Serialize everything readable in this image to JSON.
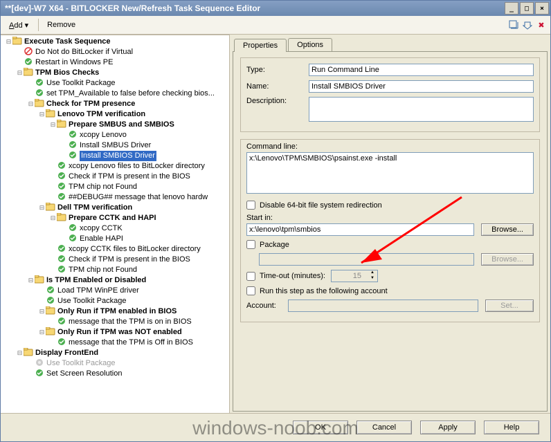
{
  "titlebar": {
    "title": "**[dev]-W7 X64 - BITLOCKER New/Refresh Task Sequence Editor"
  },
  "menu": {
    "add": "Add",
    "remove": "Remove"
  },
  "tabs": {
    "properties": "Properties",
    "options": "Options"
  },
  "properties": {
    "type_label": "Type:",
    "type_value": "Run Command Line",
    "name_label": "Name:",
    "name_value": "Install SMBIOS Driver",
    "description_label": "Description:",
    "description_value": "",
    "commandline_label": "Command line:",
    "commandline_value": "x:\\Lenovo\\TPM\\SMBIOS\\psainst.exe -install",
    "disable64_label": "Disable 64-bit file system redirection",
    "startin_label": "Start in:",
    "startin_value": "x:\\lenovo\\tpm\\smbios",
    "browse_label": "Browse...",
    "package_label": "Package",
    "package_value": "",
    "timeout_label": "Time-out (minutes):",
    "timeout_value": "15",
    "runas_label": "Run this step as the following account",
    "account_label": "Account:",
    "account_value": "",
    "set_label": "Set..."
  },
  "buttons": {
    "ok": "OK",
    "cancel": "Cancel",
    "apply": "Apply",
    "help": "Help"
  },
  "watermark": "windows-noob.com",
  "tree": [
    {
      "d": 0,
      "t": "g",
      "l": "Execute Task Sequence",
      "tw": "-"
    },
    {
      "d": 1,
      "t": "x",
      "l": "Do Not do BitLocker if Virtual"
    },
    {
      "d": 1,
      "t": "s",
      "l": "Restart in Windows PE"
    },
    {
      "d": 1,
      "t": "g",
      "l": "TPM Bios Checks",
      "tw": "-"
    },
    {
      "d": 2,
      "t": "s",
      "l": "Use Toolkit Package"
    },
    {
      "d": 2,
      "t": "s",
      "l": "set TPM_Available to false before checking bios..."
    },
    {
      "d": 2,
      "t": "g",
      "l": "Check for TPM presence",
      "tw": "-"
    },
    {
      "d": 3,
      "t": "g",
      "l": "Lenovo TPM verification",
      "tw": "-"
    },
    {
      "d": 4,
      "t": "g",
      "l": "Prepare SMBUS and SMBIOS",
      "tw": "-"
    },
    {
      "d": 5,
      "t": "s",
      "l": "xcopy Lenovo"
    },
    {
      "d": 5,
      "t": "s",
      "l": "Install SMBUS Driver"
    },
    {
      "d": 5,
      "t": "s",
      "l": "Install SMBIOS Driver",
      "sel": true
    },
    {
      "d": 4,
      "t": "s",
      "l": "xcopy Lenovo files to BitLocker directory"
    },
    {
      "d": 4,
      "t": "s",
      "l": "Check if TPM is present in the BIOS"
    },
    {
      "d": 4,
      "t": "s",
      "l": "TPM chip not Found"
    },
    {
      "d": 4,
      "t": "s",
      "l": "##DEBUG## message that lenovo hardw"
    },
    {
      "d": 3,
      "t": "g",
      "l": "Dell TPM verification",
      "tw": "-"
    },
    {
      "d": 4,
      "t": "g",
      "l": "Prepare CCTK and HAPI",
      "tw": "-"
    },
    {
      "d": 5,
      "t": "s",
      "l": "xcopy CCTK"
    },
    {
      "d": 5,
      "t": "s",
      "l": "Enable HAPI"
    },
    {
      "d": 4,
      "t": "s",
      "l": "xcopy CCTK files to BitLocker directory"
    },
    {
      "d": 4,
      "t": "s",
      "l": "Check if TPM is present in the BIOS"
    },
    {
      "d": 4,
      "t": "s",
      "l": "TPM chip not Found"
    },
    {
      "d": 2,
      "t": "g",
      "l": "Is TPM Enabled or Disabled",
      "tw": "-"
    },
    {
      "d": 3,
      "t": "s",
      "l": "Load TPM WinPE driver"
    },
    {
      "d": 3,
      "t": "s",
      "l": "Use Toolkit Package"
    },
    {
      "d": 3,
      "t": "g",
      "l": "Only Run if TPM enabled in BIOS",
      "tw": "-"
    },
    {
      "d": 4,
      "t": "s",
      "l": "message that the  TPM is on in BIOS"
    },
    {
      "d": 3,
      "t": "g",
      "l": "Only Run if TPM was NOT enabled",
      "tw": "-"
    },
    {
      "d": 4,
      "t": "s",
      "l": "message that the  TPM is Off in BIOS"
    },
    {
      "d": 1,
      "t": "g",
      "l": "Display FrontEnd",
      "tw": "-"
    },
    {
      "d": 2,
      "t": "d",
      "l": "Use Toolkit Package"
    },
    {
      "d": 2,
      "t": "s",
      "l": "Set Screen Resolution"
    }
  ]
}
